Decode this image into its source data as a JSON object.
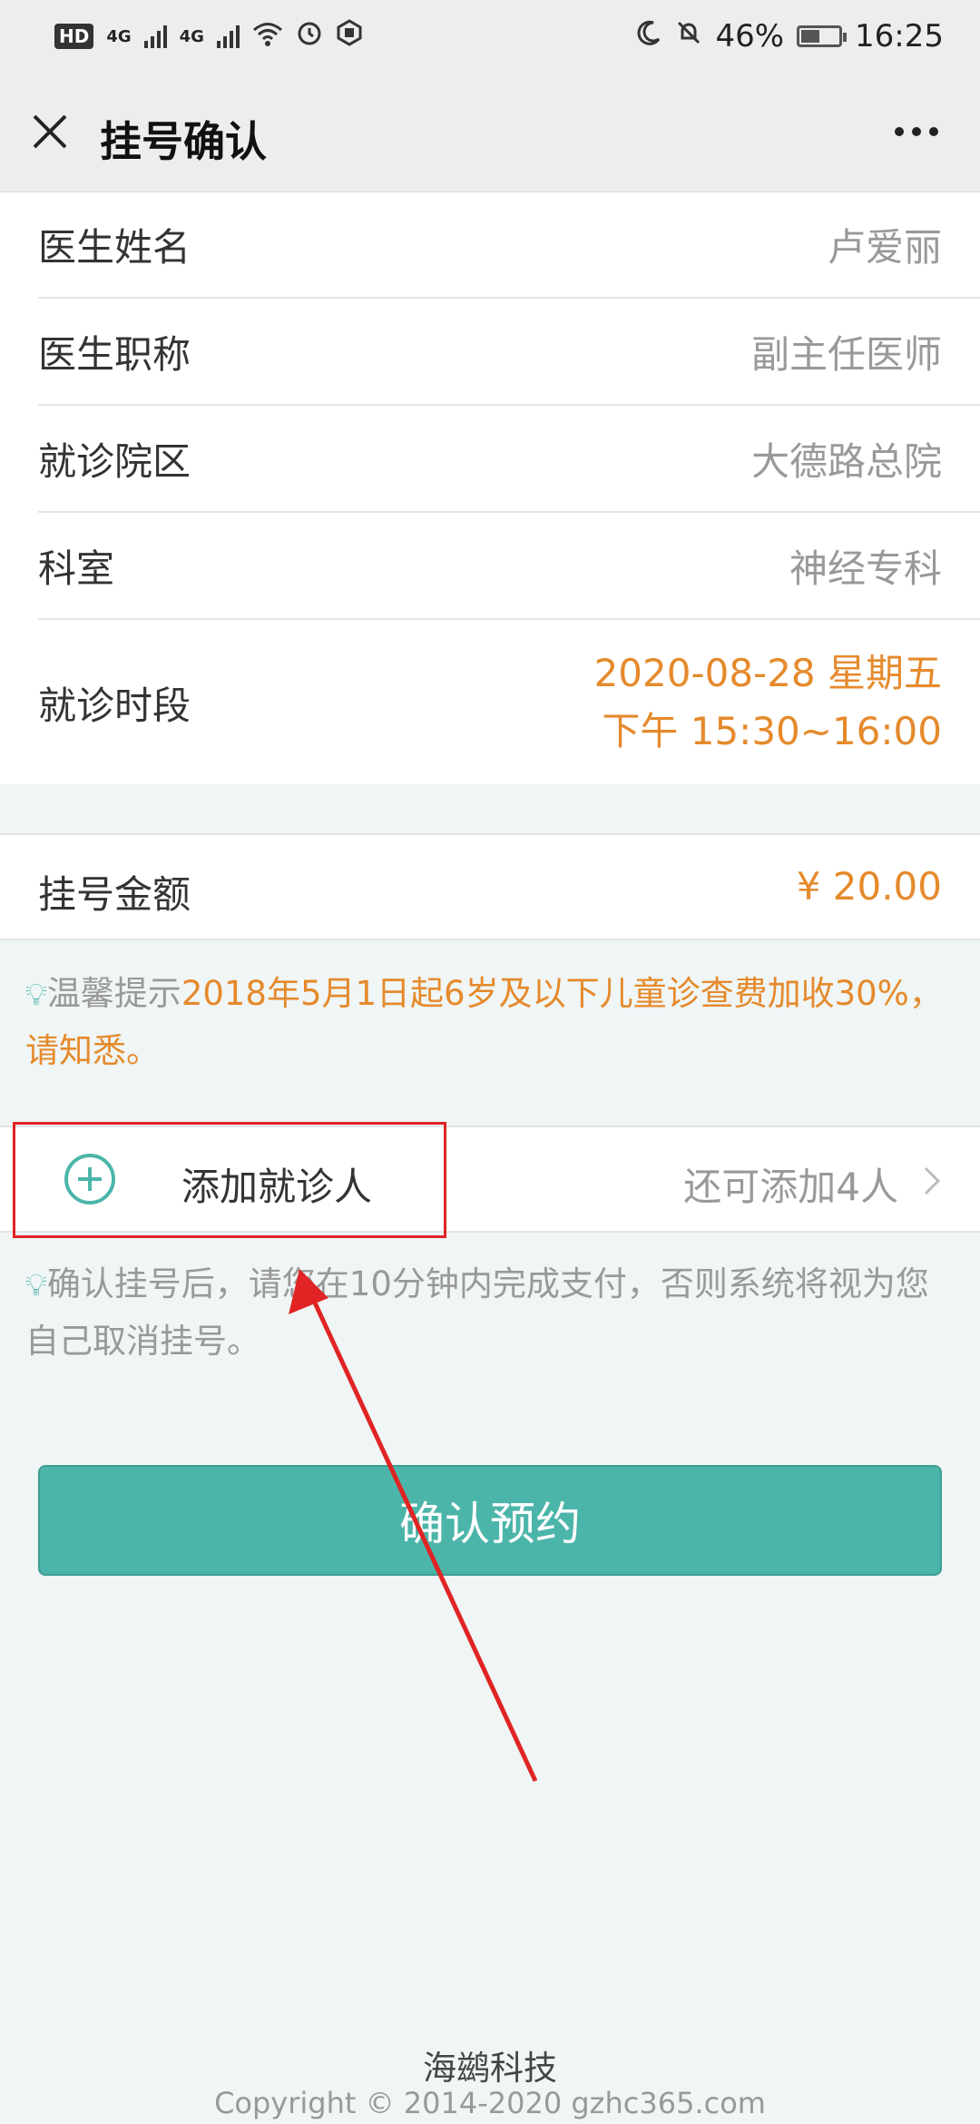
{
  "status_bar": {
    "hd": "HD",
    "sim1": "4G",
    "sim2": "4G",
    "battery": "46%",
    "time": "16:25"
  },
  "nav": {
    "title": "挂号确认"
  },
  "details": {
    "doctor_name_label": "医生姓名",
    "doctor_name": "卢爱丽",
    "doctor_title_label": "医生职称",
    "doctor_title": "副主任医师",
    "campus_label": "就诊院区",
    "campus": "大德路总院",
    "department_label": "科室",
    "department": "神经专科",
    "time_label": "就诊时段",
    "time_date": "2020-08-28 星期五",
    "time_range": "下午 15:30~16:00"
  },
  "fee": {
    "label": "挂号金额",
    "value": "¥ 20.00"
  },
  "tip1": {
    "prefix": "温馨提示",
    "highlight": "2018年5月1日起6岁及以下儿童诊查费加收30%，请知悉。"
  },
  "add_patient": {
    "label": "添加就诊人",
    "remaining": "还可添加4人"
  },
  "tip2": {
    "text": "确认挂号后，请您在10分钟内完成支付，否则系统将视为您自己取消挂号。"
  },
  "confirm_button": "确认预约",
  "footer": {
    "company": "海鹚科技",
    "copyright": "Copyright © 2014-2020 gzhc365.com"
  },
  "colors": {
    "accent": "#4cb5aa",
    "highlight": "#e58a2c",
    "annotation": "#e02424"
  }
}
